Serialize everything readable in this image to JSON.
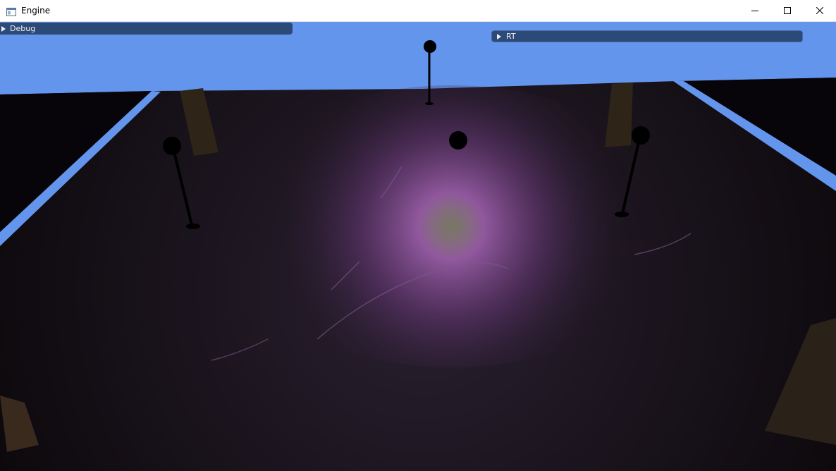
{
  "window": {
    "title": "Engine",
    "icon": "app-window-icon",
    "controls": [
      "minimize-icon",
      "maximize-icon",
      "close-icon"
    ]
  },
  "panels": {
    "debug": {
      "label": "Debug",
      "collapsed": true
    },
    "rt": {
      "label": "RT",
      "collapsed": true
    }
  },
  "scene": {
    "sky_color": "#6495ED",
    "ground_color": "#1a1220",
    "light_color": "#b45fc8"
  }
}
